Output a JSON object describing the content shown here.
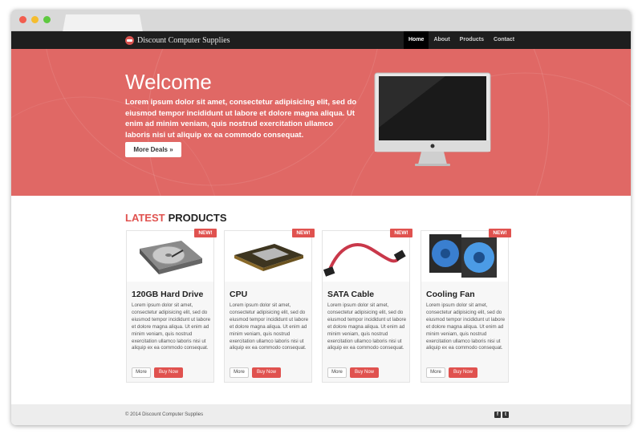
{
  "site": {
    "brand": "Discount Computer Supplies"
  },
  "nav": {
    "items": [
      {
        "label": "Home",
        "active": true
      },
      {
        "label": "About",
        "active": false
      },
      {
        "label": "Products",
        "active": false
      },
      {
        "label": "Contact",
        "active": false
      }
    ]
  },
  "hero": {
    "title": "Welcome",
    "text": "Lorem ipsum dolor sit amet, consectetur adipisicing elit, sed do eiusmod tempor incididunt ut labore et dolore magna aliqua. Ut enim ad minim veniam, quis nostrud exercitation ullamco laboris nisi ut aliquip ex ea commodo consequat.",
    "button_label": "More Deals »",
    "background_color": "#e06865"
  },
  "products_section": {
    "title_accent": "LATEST",
    "title_rest": "PRODUCTS",
    "badge": "NEW!",
    "more_label": "More",
    "buy_label": "Buy Now",
    "accent_color": "#e0524f",
    "items": [
      {
        "name": "120GB Hard Drive",
        "image": "hard-drive",
        "description": "Lorem ipsum dolor sit amet, consectetur adipisicing elit, sed do eiusmod tempor incididunt ut labore et dolore magna aliqua. Ut enim ad minim veniam, quis nostrud exercitation ullamco laboris nisi ut aliquip ex ea commodo consequat."
      },
      {
        "name": "CPU",
        "image": "cpu",
        "description": "Lorem ipsum dolor sit amet, consectetur adipisicing elit, sed do eiusmod tempor incididunt ut labore et dolore magna aliqua. Ut enim ad minim veniam, quis nostrud exercitation ullamco laboris nisi ut aliquip ex ea commodo consequat."
      },
      {
        "name": "SATA Cable",
        "image": "sata-cable",
        "description": "Lorem ipsum dolor sit amet, consectetur adipisicing elit, sed do eiusmod tempor incididunt ut labore et dolore magna aliqua. Ut enim ad minim veniam, quis nostrud exercitation ullamco laboris nisi ut aliquip ex ea commodo consequat."
      },
      {
        "name": "Cooling Fan",
        "image": "cooling-fan",
        "description": "Lorem ipsum dolor sit amet, consectetur adipisicing elit, sed do eiusmod tempor incididunt ut labore et dolore magna aliqua. Ut enim ad minim veniam, quis nostrud exercitation ullamco laboris nisi ut aliquip ex ea commodo consequat."
      }
    ]
  },
  "footer": {
    "copyright": "© 2014 Discount Computer Supplies",
    "social": [
      {
        "icon": "facebook-icon",
        "glyph": "f"
      },
      {
        "icon": "twitter-icon",
        "glyph": "t"
      }
    ]
  }
}
